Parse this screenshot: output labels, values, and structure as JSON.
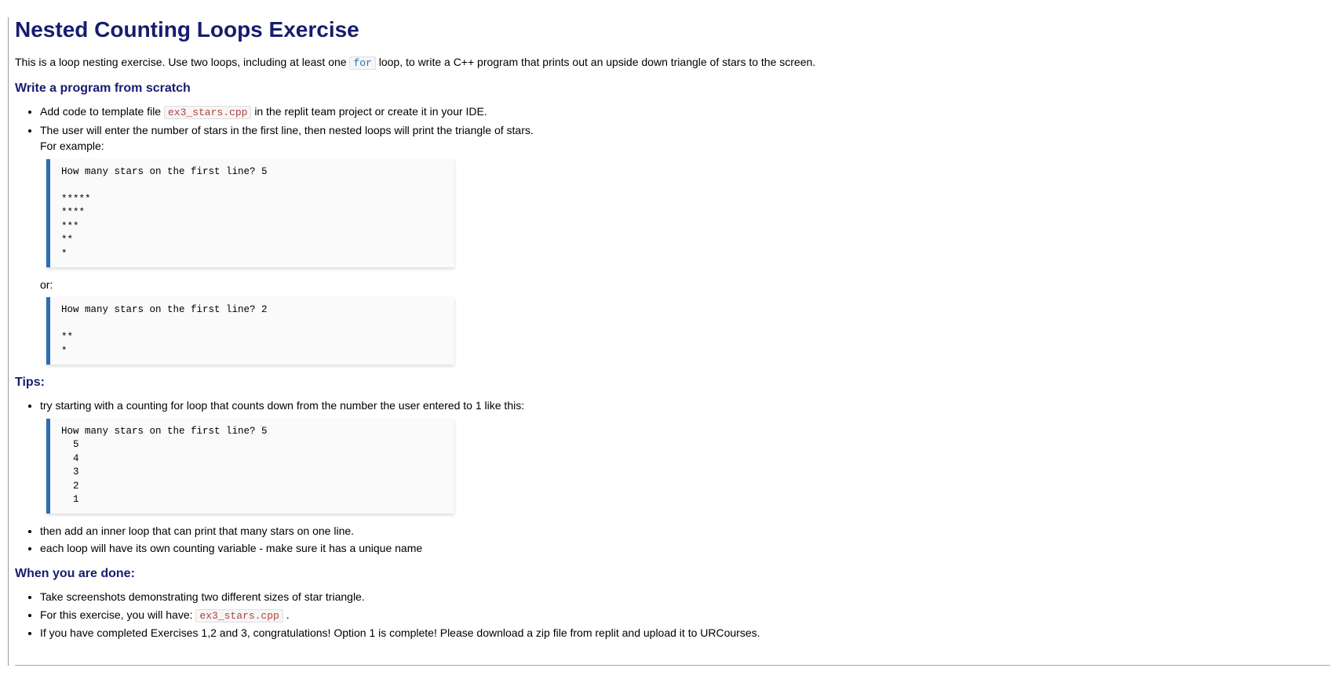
{
  "title": "Nested Counting Loops Exercise",
  "intro": {
    "part1": "This is a loop nesting exercise. Use two loops, including at least one ",
    "for_kw": "for",
    "part2": " loop, to write a C++ program that prints out an upside down triangle of stars to the screen."
  },
  "section1": {
    "heading": "Write a program from scratch",
    "li1": {
      "pre": "Add code to template file ",
      "code": "ex3_stars.cpp",
      "post": " in the replit team project or create it in your IDE."
    },
    "li2": {
      "line1": "The user will enter the number of stars in the first line, then nested loops will print the triangle of stars.",
      "line2": "For example:"
    },
    "example1": "How many stars on the first line? 5\n\n*****\n****\n***\n**\n*",
    "or_text": "or:",
    "example2": "How many stars on the first line? 2\n\n**\n*"
  },
  "section2": {
    "heading": "Tips:",
    "li1": "try starting with a counting for loop that counts down from the number the user entered to 1 like this:",
    "example3": "How many stars on the first line? 5\n  5\n  4\n  3\n  2\n  1",
    "li2": "then add an inner loop that can print that many stars on one line.",
    "li3": "each loop will have its own counting variable - make sure it has a unique name"
  },
  "section3": {
    "heading": "When you are done:",
    "li1": "Take screenshots demonstrating two different sizes of star triangle.",
    "li2": {
      "pre": "For this exercise, you will have: ",
      "code": "ex3_stars.cpp",
      "post": " ."
    },
    "li3": "If you have completed Exercises 1,2 and 3, congratulations! Option 1 is complete! Please download a zip file from replit and upload it to URCourses."
  }
}
